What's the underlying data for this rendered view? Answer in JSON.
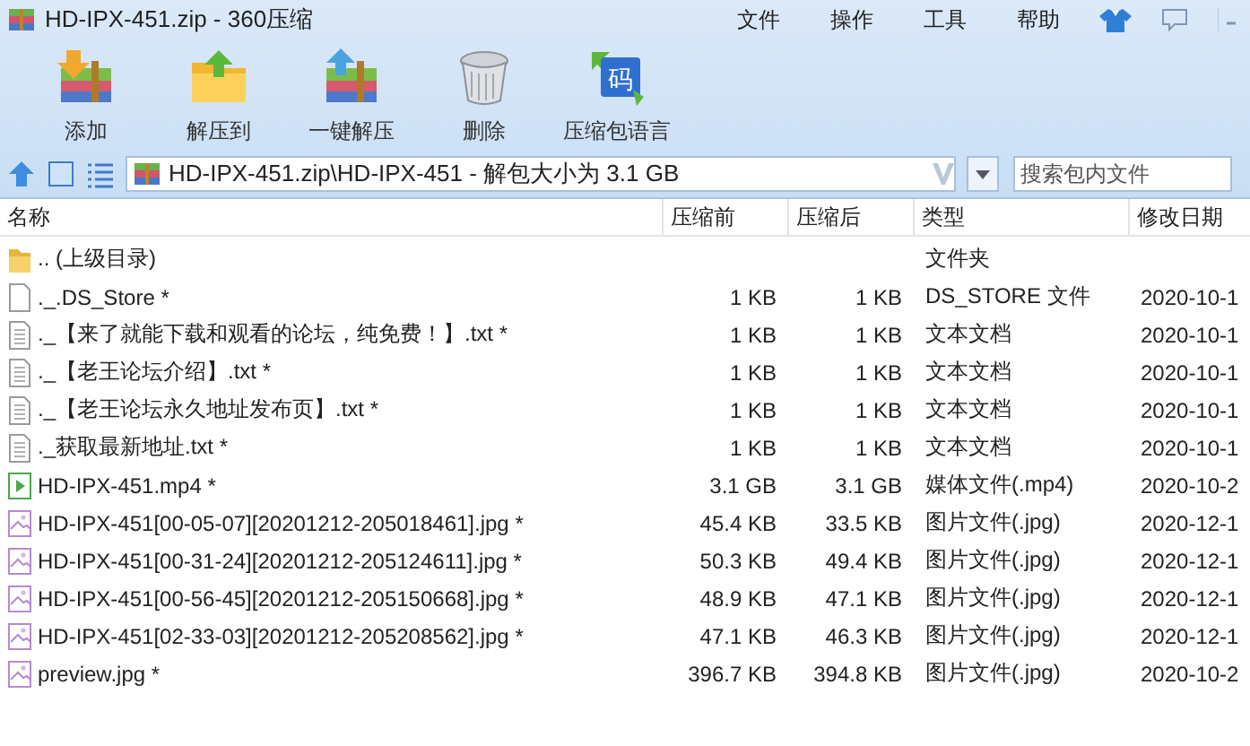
{
  "window": {
    "title": "HD-IPX-451.zip - 360压缩"
  },
  "menu": [
    "文件",
    "操作",
    "工具",
    "帮助"
  ],
  "toolbar": [
    {
      "kind": "add",
      "label": "添加"
    },
    {
      "kind": "extract",
      "label": "解压到"
    },
    {
      "kind": "quick",
      "label": "一键解压"
    },
    {
      "kind": "delete",
      "label": "删除"
    },
    {
      "kind": "language",
      "label": "压缩包语言",
      "icon_text": "码"
    }
  ],
  "address": {
    "value": "HD-IPX-451.zip\\HD-IPX-451 - 解包大小为 3.1 GB"
  },
  "search": {
    "placeholder": "搜索包内文件"
  },
  "table": {
    "columns": [
      "名称",
      "压缩前",
      "压缩后",
      "类型",
      "修改日期"
    ],
    "rows": [
      {
        "kind": "folder",
        "name": ".. (上级目录)",
        "type": "文件夹"
      },
      {
        "kind": "file",
        "name": "._.DS_Store *",
        "before": "1 KB",
        "after": "1 KB",
        "type": "DS_STORE 文件",
        "modified": "2020-10-1"
      },
      {
        "kind": "text",
        "name": "._【来了就能下载和观看的论坛，纯免费！】.txt *",
        "before": "1 KB",
        "after": "1 KB",
        "type": "文本文档",
        "modified": "2020-10-1"
      },
      {
        "kind": "text",
        "name": "._【老王论坛介绍】.txt *",
        "before": "1 KB",
        "after": "1 KB",
        "type": "文本文档",
        "modified": "2020-10-1"
      },
      {
        "kind": "text",
        "name": "._【老王论坛永久地址发布页】.txt *",
        "before": "1 KB",
        "after": "1 KB",
        "type": "文本文档",
        "modified": "2020-10-1"
      },
      {
        "kind": "text",
        "name": "._获取最新地址.txt *",
        "before": "1 KB",
        "after": "1 KB",
        "type": "文本文档",
        "modified": "2020-10-1"
      },
      {
        "kind": "video",
        "name": "HD-IPX-451.mp4 *",
        "before": "3.1 GB",
        "after": "3.1 GB",
        "type": "媒体文件(.mp4)",
        "modified": "2020-10-2"
      },
      {
        "kind": "image",
        "name": "HD-IPX-451[00-05-07][20201212-205018461].jpg *",
        "before": "45.4 KB",
        "after": "33.5 KB",
        "type": "图片文件(.jpg)",
        "modified": "2020-12-1"
      },
      {
        "kind": "image",
        "name": "HD-IPX-451[00-31-24][20201212-205124611].jpg *",
        "before": "50.3 KB",
        "after": "49.4 KB",
        "type": "图片文件(.jpg)",
        "modified": "2020-12-1"
      },
      {
        "kind": "image",
        "name": "HD-IPX-451[00-56-45][20201212-205150668].jpg *",
        "before": "48.9 KB",
        "after": "47.1 KB",
        "type": "图片文件(.jpg)",
        "modified": "2020-12-1"
      },
      {
        "kind": "image",
        "name": "HD-IPX-451[02-33-03][20201212-205208562].jpg *",
        "before": "47.1 KB",
        "after": "46.3 KB",
        "type": "图片文件(.jpg)",
        "modified": "2020-12-1"
      },
      {
        "kind": "image",
        "name": "preview.jpg *",
        "before": "396.7 KB",
        "after": "394.8 KB",
        "type": "图片文件(.jpg)",
        "modified": "2020-10-2"
      }
    ]
  }
}
